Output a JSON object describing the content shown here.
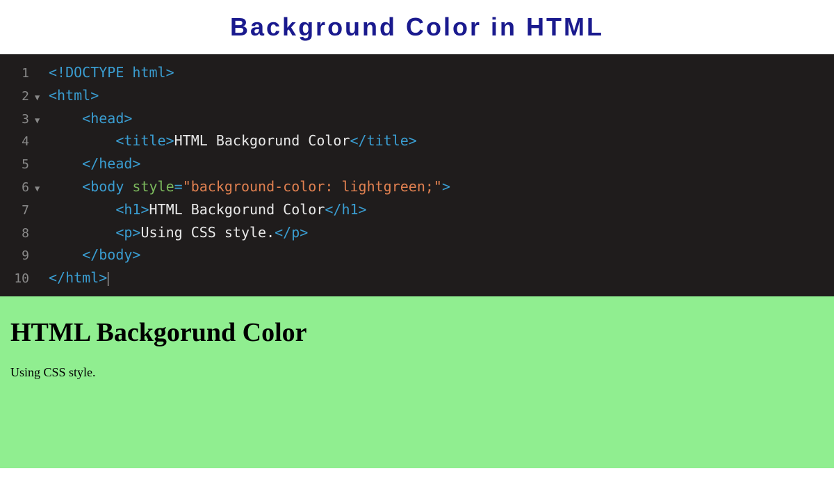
{
  "header": {
    "title": "Background Color in HTML"
  },
  "editor": {
    "lines": [
      {
        "num": "1",
        "fold": "",
        "tokens": [
          {
            "t": "tag",
            "v": "<!DOCTYPE html>"
          }
        ]
      },
      {
        "num": "2",
        "fold": "▼",
        "tokens": [
          {
            "t": "tag",
            "v": "<html>"
          }
        ]
      },
      {
        "num": "3",
        "fold": "▼",
        "indent": 1,
        "tokens": [
          {
            "t": "tag",
            "v": "<head>"
          }
        ]
      },
      {
        "num": "4",
        "fold": "",
        "indent": 2,
        "tokens": [
          {
            "t": "tag",
            "v": "<title>"
          },
          {
            "t": "text",
            "v": "HTML Backgorund Color"
          },
          {
            "t": "tag",
            "v": "</title>"
          }
        ]
      },
      {
        "num": "5",
        "fold": "",
        "indent": 1,
        "tokens": [
          {
            "t": "tag",
            "v": "</head>"
          }
        ]
      },
      {
        "num": "6",
        "fold": "▼",
        "indent": 1,
        "tokens": [
          {
            "t": "tag",
            "v": "<body "
          },
          {
            "t": "attr",
            "v": "style"
          },
          {
            "t": "tag",
            "v": "="
          },
          {
            "t": "val",
            "v": "\"background-color: lightgreen;\""
          },
          {
            "t": "tag",
            "v": ">"
          }
        ]
      },
      {
        "num": "7",
        "fold": "",
        "indent": 2,
        "tokens": [
          {
            "t": "tag",
            "v": "<h1>"
          },
          {
            "t": "text",
            "v": "HTML Backgorund Color"
          },
          {
            "t": "tag",
            "v": "</h1>"
          }
        ]
      },
      {
        "num": "8",
        "fold": "",
        "indent": 2,
        "tokens": [
          {
            "t": "tag",
            "v": "<p>"
          },
          {
            "t": "text",
            "v": "Using CSS style."
          },
          {
            "t": "tag",
            "v": "</p>"
          }
        ]
      },
      {
        "num": "9",
        "fold": "",
        "indent": 1,
        "tokens": [
          {
            "t": "tag",
            "v": "</body>"
          }
        ]
      },
      {
        "num": "10",
        "fold": "",
        "tokens": [
          {
            "t": "tag",
            "v": "</html>"
          }
        ],
        "cursor": true
      }
    ]
  },
  "preview": {
    "heading": "HTML Backgorund Color",
    "paragraph": "Using CSS style."
  }
}
